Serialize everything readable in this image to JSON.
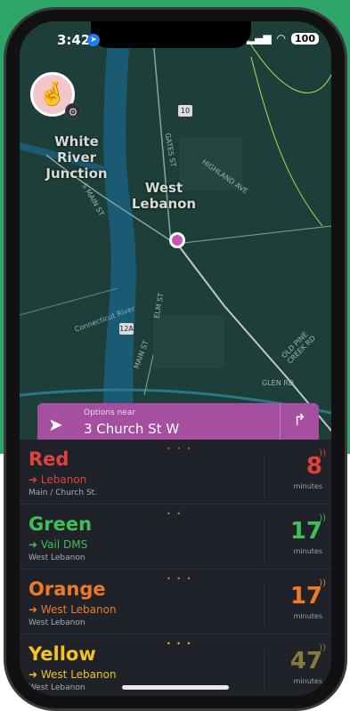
{
  "status_bar": {
    "time": "3:42",
    "battery": "100"
  },
  "map": {
    "places": [
      "White River Junction",
      "West Lebanon"
    ],
    "road_labels": [
      "S MAIN ST",
      "GATES ST",
      "HIGHLAND AVE",
      "MAIN ST",
      "ELM ST",
      "GLEN RD",
      "OLD PINE CREEK RD",
      "Connecticut River"
    ],
    "shields": [
      "10",
      "12A"
    ]
  },
  "options_card": {
    "label": "Options near",
    "value": "3 Church St W"
  },
  "routes": [
    {
      "name": "Red",
      "destination": "Lebanon",
      "stop": "Main / Church St.",
      "eta": "8",
      "unit": "minutes",
      "color": "#e0413a",
      "eta_color": "#e0413a",
      "dots": "• • •"
    },
    {
      "name": "Green",
      "destination": "Vail DMS",
      "stop": "West Lebanon",
      "eta": "17",
      "unit": "minutes",
      "color": "#3fbf57",
      "eta_color": "#3fbf57",
      "dots": "• •"
    },
    {
      "name": "Orange",
      "destination": "West Lebanon",
      "stop": "West Lebanon",
      "eta": "17",
      "unit": "minutes",
      "color": "#f07a24",
      "eta_color": "#f07a24",
      "dots": "• • •"
    },
    {
      "name": "Yellow",
      "destination": "West Lebanon",
      "stop": "West Lebanon",
      "eta": "47",
      "unit": "minutes",
      "color": "#f2c322",
      "eta_color": "#8a7a3c",
      "dots": "• • •"
    }
  ],
  "icons": {
    "location": "location-arrow-icon",
    "nav": "navigation-arrow-icon",
    "directions": "turn-right-icon",
    "destination": "arrow-circle-icon",
    "live": "live-signal-icon",
    "settings": "gear-icon",
    "avatar": "fingers-crossed-emoji"
  }
}
